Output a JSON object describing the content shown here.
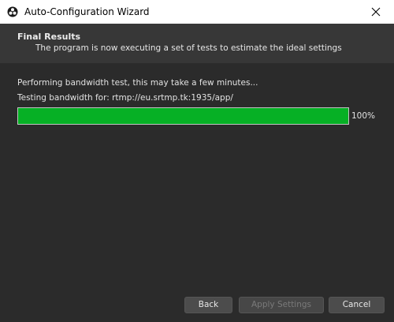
{
  "window": {
    "title": "Auto-Configuration Wizard",
    "app_icon": "obs-logo-icon",
    "close_icon": "close-icon"
  },
  "header": {
    "title": "Final Results",
    "subtitle": "The program is now executing a set of tests to estimate the ideal settings"
  },
  "status": {
    "line1": "Performing bandwidth test, this may take a few minutes...",
    "line2": "Testing bandwidth for: rtmp://eu.srtmp.tk:1935/app/"
  },
  "progress": {
    "value": 100,
    "label": "100%",
    "color": "#06b025"
  },
  "buttons": {
    "back": "Back",
    "apply": "Apply Settings",
    "cancel": "Cancel"
  },
  "colors": {
    "background": "#2b2b2b",
    "header": "#373737",
    "button": "#4c4c4c"
  }
}
